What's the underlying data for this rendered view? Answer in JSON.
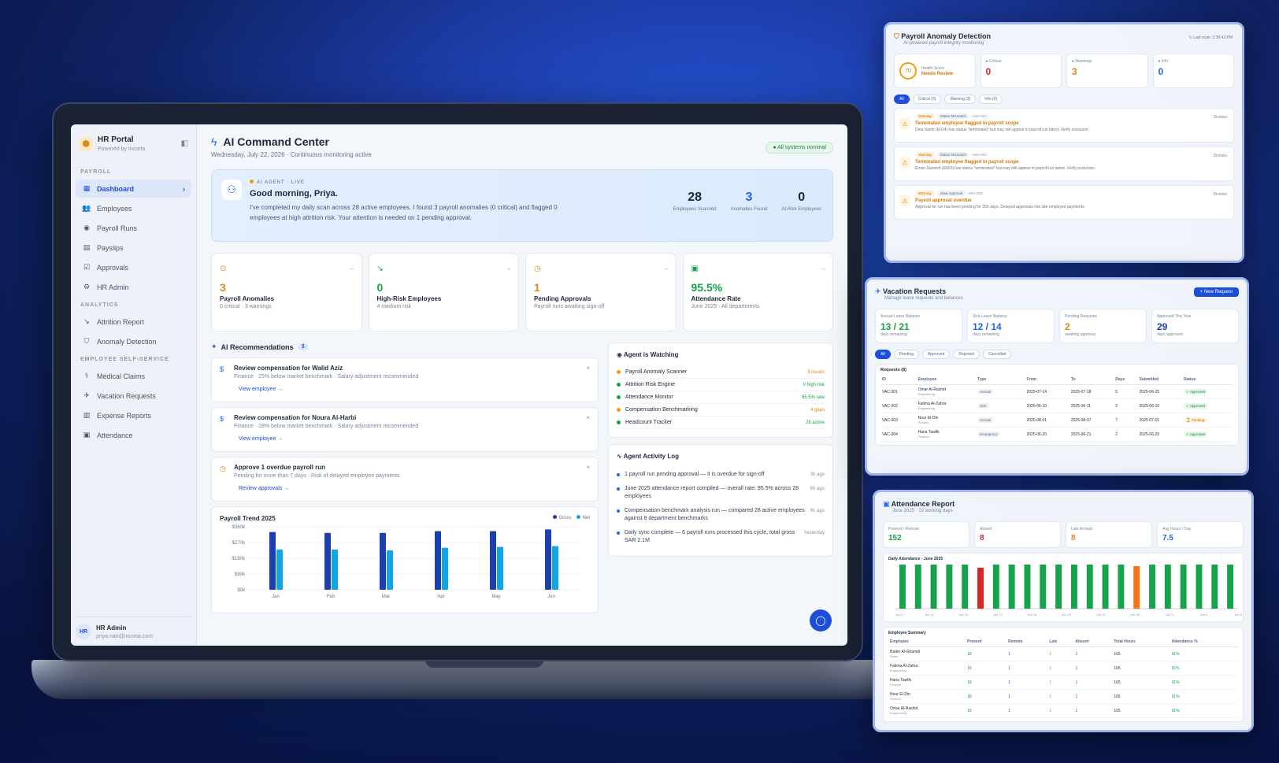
{
  "sidebar": {
    "brand": "HR Portal",
    "brand_sub": "Powered by Incorta",
    "section_payroll": "PAYROLL",
    "payroll_items": [
      {
        "label": "Dashboard",
        "icon": "grid-icon"
      },
      {
        "label": "Employees",
        "icon": "users-icon"
      },
      {
        "label": "Payroll Runs",
        "icon": "play-icon"
      },
      {
        "label": "Payslips",
        "icon": "doc-icon"
      },
      {
        "label": "Approvals",
        "icon": "check-icon"
      },
      {
        "label": "HR Admin",
        "icon": "gear-icon"
      }
    ],
    "section_analytics": "ANALYTICS",
    "analytics_items": [
      {
        "label": "Attrition Report"
      },
      {
        "label": "Anomaly Detection"
      }
    ],
    "section_self": "EMPLOYEE SELF-SERVICE",
    "self_items": [
      {
        "label": "Medical Claims"
      },
      {
        "label": "Vacation Requests"
      },
      {
        "label": "Expense Reports"
      },
      {
        "label": "Attendance"
      }
    ],
    "user_initials": "HR",
    "user_name": "HR Admin",
    "user_email": "priya.nair@incorta.com"
  },
  "main": {
    "title": "AI Command Center",
    "subtitle": "Wednesday, July 22, 2026 · Continuous monitoring active",
    "status": "All systems nominal",
    "hero": {
      "tag": "AI AGENT · LIVE",
      "greeting": "Good morning, Priya.",
      "message": "I've completed my daily scan across 28 active employees. I found 3 payroll anomalies (0 critical) and flagged 0 employees at high attrition risk. Your attention is needed on 1 pending approval.",
      "stats": [
        {
          "value": "28",
          "label": "Employees Scanned"
        },
        {
          "value": "3",
          "label": "Anomalies Found"
        },
        {
          "value": "0",
          "label": "At-Risk Employees"
        }
      ]
    },
    "kpis": [
      {
        "value": "3",
        "label": "Payroll Anomalies",
        "sub": "0 critical · 3 warnings",
        "color": "#e0851a"
      },
      {
        "value": "0",
        "label": "High-Risk Employees",
        "sub": "4 medium risk",
        "color": "#16a34a"
      },
      {
        "value": "1",
        "label": "Pending Approvals",
        "sub": "Payroll runs awaiting sign-off",
        "color": "#e0851a"
      },
      {
        "value": "95.5%",
        "label": "Attendance Rate",
        "sub": "June 2025 · All departments",
        "color": "#16a34a"
      }
    ],
    "rec_title": "AI Recommendations",
    "rec_count": "3",
    "recs": [
      {
        "title": "Review compensation for Walid Aziz",
        "sub": "Finance · 25% below market benchmark · Salary adjustment recommended",
        "link": "View employee"
      },
      {
        "title": "Review compensation for Noura Al-Harbi",
        "sub": "Finance · 28% below market benchmark · Salary adjustment recommended",
        "link": "View employee"
      },
      {
        "title": "Approve 1 overdue payroll run",
        "sub": "Pending for more than 7 days · Risk of delayed employee payments",
        "link": "Review approvals"
      }
    ],
    "watch_title": "Agent is Watching",
    "watch": [
      {
        "name": "Payroll Anomaly Scanner",
        "status": "3 issues",
        "color": "#e0851a"
      },
      {
        "name": "Attrition Risk Engine",
        "status": "0 high risk",
        "color": "#16a34a"
      },
      {
        "name": "Attendance Monitor",
        "status": "95.5% rate",
        "color": "#16a34a"
      },
      {
        "name": "Compensation Benchmarking",
        "status": "4 gaps",
        "color": "#e0851a"
      },
      {
        "name": "Headcount Tracker",
        "status": "28 active",
        "color": "#16a34a"
      }
    ],
    "log_title": "Agent Activity Log",
    "log": [
      {
        "text": "1 payroll run pending approval — it is overdue for sign-off",
        "time": "3h ago"
      },
      {
        "text": "June 2025 attendance report compiled — overall rate: 95.5% across 28 employees",
        "time": "6h ago"
      },
      {
        "text": "Compensation benchmark analysis run — compared 28 active employees against 8 department benchmarks",
        "time": "9h ago"
      },
      {
        "text": "Daily sync complete — 6 payroll runs processed this cycle, total gross SAR 2.1M",
        "time": "Yesterday"
      }
    ]
  },
  "chart_data": {
    "type": "bar",
    "title": "Payroll Trend 2025",
    "categories": [
      "Jan",
      "Feb",
      "Mar",
      "Apr",
      "May",
      "Jun"
    ],
    "yticks": [
      "$360k",
      "$270k",
      "$180k",
      "$90k",
      "$0k"
    ],
    "ylim": [
      0,
      360000
    ],
    "series": [
      {
        "name": "Gross",
        "values": [
          330000,
          325000,
          325000,
          335000,
          335000,
          345000
        ],
        "color": "#1e40af"
      },
      {
        "name": "Net",
        "values": [
          230000,
          230000,
          225000,
          240000,
          245000,
          250000
        ],
        "color": "#0ea5e9"
      }
    ]
  },
  "anomaly": {
    "title": "Payroll Anomaly Detection",
    "sub": "AI-powered payroll integrity monitoring",
    "last_scan": "Last scan: 2:38:43 PM",
    "score": "70",
    "score_label": "Health Score",
    "score_status": "Needs Review",
    "tiles": [
      {
        "label": "Critical",
        "value": "0",
        "color": "#dc2626"
      },
      {
        "label": "Warnings",
        "value": "3",
        "color": "#e0851a"
      },
      {
        "label": "Info",
        "value": "0",
        "color": "#2563eb"
      }
    ],
    "filters": [
      "All",
      "Critical (0)",
      "Warning (3)",
      "Info (0)"
    ],
    "items": [
      {
        "sev": "Warning",
        "type": "Status Mismatch",
        "id": "ANO-001",
        "title": "Terminated employee flagged in payroll scope",
        "desc": "Dina Samir (E014) has status \"terminated\" but may still appear in payroll run latest. Verify exclusion.",
        "dismiss": "Dismiss"
      },
      {
        "sev": "Warning",
        "type": "Status Mismatch",
        "id": "ANO-002",
        "title": "Terminated employee flagged in payroll scope",
        "desc": "Eman Darwish (E603) has status \"terminated\" but may still appear in payroll run latest. Verify exclusion.",
        "dismiss": "Dismiss"
      },
      {
        "sev": "Warning",
        "type": "Slow Approval",
        "id": "ANO-003",
        "title": "Payroll approval overdue",
        "desc": "Approval for run has been pending for 356 days. Delayed approvals risk late employee payments.",
        "dismiss": "Dismiss"
      }
    ]
  },
  "vacation": {
    "title": "Vacation Requests",
    "sub": "Manage leave requests and balances",
    "new_btn": "+ New Request",
    "tiles": [
      {
        "label": "Annual Leave Balance",
        "value": "13 / 21",
        "sub": "days remaining",
        "color": "#16a34a"
      },
      {
        "label": "Sick Leave Balance",
        "value": "12 / 14",
        "sub": "days remaining",
        "color": "#2563eb"
      },
      {
        "label": "Pending Requests",
        "value": "2",
        "sub": "awaiting approval",
        "color": "#e0851a"
      },
      {
        "label": "Approved This Year",
        "value": "29",
        "sub": "days approved",
        "color": "#1e40af"
      }
    ],
    "filters": [
      "All",
      "Pending",
      "Approved",
      "Rejected",
      "Cancelled"
    ],
    "table_title": "Requests (8)",
    "headers": [
      "ID",
      "Employee",
      "Type",
      "From",
      "To",
      "Days",
      "Submitted",
      "Status"
    ],
    "rows": [
      {
        "id": "VAC-001",
        "name": "Omar Al-Rashid",
        "dept": "Engineering",
        "type": "Annual",
        "from": "2025-07-14",
        "to": "2025-07-18",
        "days": "5",
        "submitted": "2025-06-25",
        "status": "✓ Approved"
      },
      {
        "id": "VAC-002",
        "name": "Fatima Al-Zahra",
        "dept": "Engineering",
        "type": "Sick",
        "from": "2025-06-10",
        "to": "2025-06-11",
        "days": "2",
        "submitted": "2025-06-10",
        "status": "✓ Approved"
      },
      {
        "id": "VAC-003",
        "name": "Nour El-Din",
        "dept": "Product",
        "type": "Annual",
        "from": "2025-08-01",
        "to": "2025-08-07",
        "days": "7",
        "submitted": "2025-07-01",
        "status": "⌛ Pending"
      },
      {
        "id": "VAC-004",
        "name": "Hana Tawfik",
        "dept": "Finance",
        "type": "Emergency",
        "from": "2025-06-20",
        "to": "2025-06-21",
        "days": "2",
        "submitted": "2025-06-20",
        "status": "✓ Approved"
      }
    ]
  },
  "attendance": {
    "title": "Attendance Report",
    "sub": "June 2025 · 22 working days",
    "tiles": [
      {
        "label": "Present / Remote",
        "value": "152",
        "color": "#16a34a"
      },
      {
        "label": "Absent",
        "value": "8",
        "color": "#dc2626"
      },
      {
        "label": "Late Arrivals",
        "value": "8",
        "color": "#e0851a"
      },
      {
        "label": "Avg Hours / Day",
        "value": "7.5",
        "color": "#2563eb"
      }
    ],
    "chart_title": "Daily Attendance - June 2025",
    "daily": [
      28,
      28,
      28,
      28,
      28,
      26,
      28,
      28,
      28,
      28,
      28,
      28,
      28,
      28,
      28,
      27,
      28,
      28,
      28,
      28,
      28,
      28
    ],
    "daily_colors": [
      "g",
      "g",
      "g",
      "g",
      "g",
      "r",
      "g",
      "g",
      "g",
      "g",
      "g",
      "g",
      "g",
      "g",
      "g",
      "o",
      "g",
      "g",
      "g",
      "g",
      "g",
      "g"
    ],
    "axis_labels": [
      "Jun 1",
      "Jun 11",
      "Jun 16",
      "Jun 17",
      "Jun 18",
      "Jun 22",
      "Jun 24",
      "Jun 28",
      "Jun 3",
      "Jun 4",
      "Jun 8"
    ],
    "summary_title": "Employee Summary",
    "headers": [
      "Employee",
      "Present",
      "Remote",
      "Late",
      "Absent",
      "Total Hours",
      "Attendance %"
    ],
    "rows": [
      {
        "name": "Bader Al-Ghamdi",
        "dept": "Sales",
        "present": "18",
        "remote": "1",
        "late": "1",
        "absent": "1",
        "hours": "165",
        "pct": "91%"
      },
      {
        "name": "Fatima Al-Zahra",
        "dept": "Engineering",
        "present": "18",
        "remote": "1",
        "late": "1",
        "absent": "1",
        "hours": "165",
        "pct": "91%"
      },
      {
        "name": "Hana Tawfik",
        "dept": "Finance",
        "present": "18",
        "remote": "1",
        "late": "1",
        "absent": "1",
        "hours": "165",
        "pct": "91%"
      },
      {
        "name": "Nour El-Din",
        "dept": "Product",
        "present": "18",
        "remote": "1",
        "late": "1",
        "absent": "1",
        "hours": "165",
        "pct": "91%"
      },
      {
        "name": "Omar Al-Rashid",
        "dept": "Engineering",
        "present": "18",
        "remote": "1",
        "late": "1",
        "absent": "1",
        "hours": "165",
        "pct": "91%"
      }
    ]
  }
}
